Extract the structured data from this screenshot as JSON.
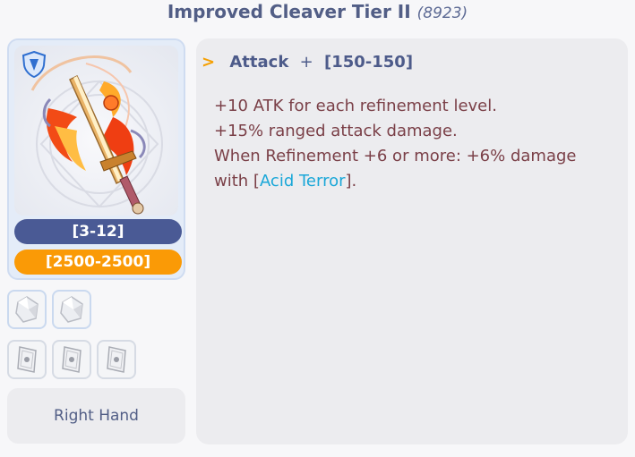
{
  "item": {
    "name": "Improved Cleaver Tier II",
    "id": "(8923)",
    "level_range": "[3-12]",
    "price_range": "[2500-2500]",
    "location": "Right Hand"
  },
  "stat": {
    "name": "Attack",
    "plus": "+",
    "value": "[150-150]"
  },
  "description": {
    "line1": "+10 ATK for each refinement level.",
    "line2": "+15% ranged attack damage.",
    "line3": "When Refinement +6 or more: +6% damage",
    "line4_prefix": "with [",
    "line4_link": "Acid Terror",
    "line4_suffix": "]."
  },
  "slots": {
    "enchant_slots": [
      "crystal-icon",
      "crystal-icon"
    ],
    "card_slots": [
      "card-icon",
      "card-icon",
      "card-icon"
    ]
  },
  "colors": {
    "title": "#525e86",
    "level_pill": "#4a5a95",
    "price_pill": "#fa9a06",
    "description_text": "#7a3f47",
    "link": "#1aa7d8",
    "stat_arrow": "#f5a003"
  }
}
